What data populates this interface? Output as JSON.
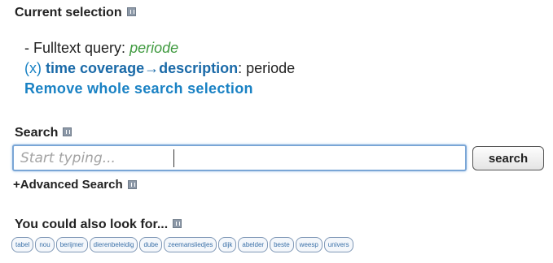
{
  "current_selection": {
    "heading": "Current selection",
    "fulltext_prefix": "- Fulltext query:",
    "fulltext_value": "periode",
    "remove_x": "(x)",
    "facet_left": "time coverage",
    "facet_arrow": "→",
    "facet_right": "description",
    "facet_sep": ":",
    "facet_value": "periode",
    "remove_all": "Remove whole search selection"
  },
  "search": {
    "heading": "Search",
    "placeholder": "Start typing...",
    "value": "",
    "button_label": "search",
    "advanced_label": "+Advanced Search"
  },
  "also_look": {
    "heading": "You could also look for...",
    "tags": [
      "tabel",
      "nou",
      "berijmer",
      "dierenbeleidig",
      "dube",
      "zeemansliedjes",
      "dijk",
      "abelder",
      "beste",
      "weesp",
      "univers"
    ]
  },
  "colors": {
    "link": "#1a82c4",
    "query_value": "#3f9a3f",
    "input_border": "#7aa6d6"
  }
}
